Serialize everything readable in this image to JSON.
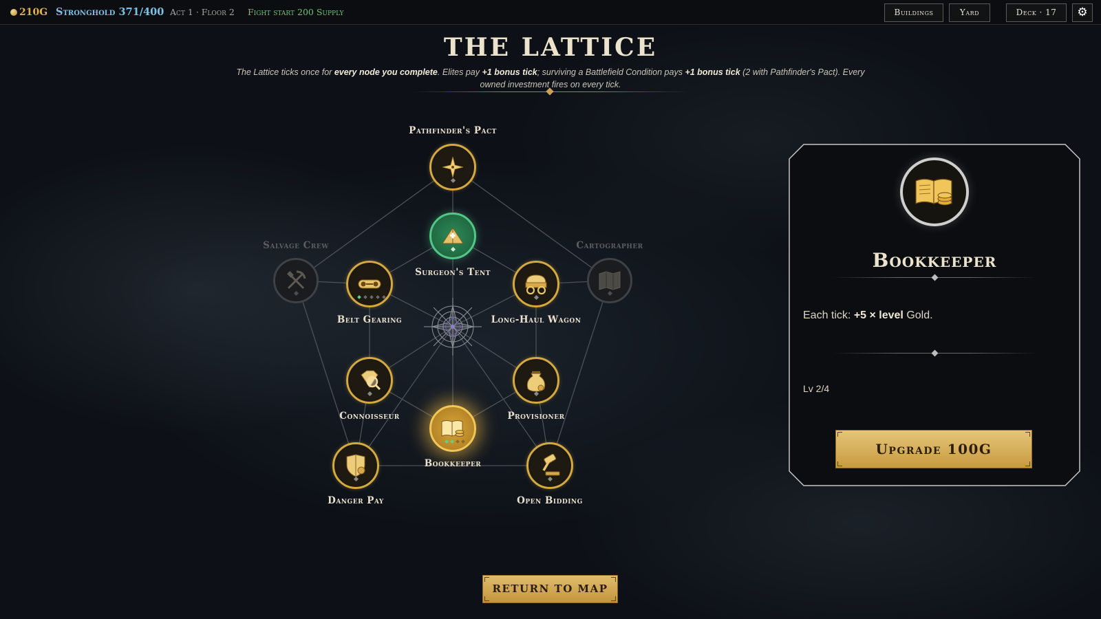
{
  "topbar": {
    "gold": "210G",
    "stronghold": "Stronghold 371/400",
    "act_floor": "Act 1 · Floor 2",
    "fight_start": "Fight start 200 Supply",
    "buttons": {
      "buildings": "Buildings",
      "yard": "Yard",
      "deck": "Deck · 17"
    },
    "settings_icon": "gear-icon"
  },
  "header": {
    "title": "THE LATTICE",
    "description_parts": [
      "The Lattice ticks once for ",
      "every node you complete",
      ". Elites pay ",
      "+1 bonus tick",
      "; surviving a Battlefield Condition pays ",
      "+1 bonus tick",
      " (2 with Pathfinder's Pact). Every owned investment fires on every tick."
    ]
  },
  "lattice": {
    "center_icon": "compass-rose-icon",
    "nodes": [
      {
        "id": "pathfinders-pact",
        "label": "Pathfinder's Pact",
        "icon": "compass-star-icon",
        "state": "owned"
      },
      {
        "id": "surgeons-tent",
        "label": "Surgeon's Tent",
        "icon": "medical-tent-icon",
        "state": "available"
      },
      {
        "id": "salvage-crew",
        "label": "Salvage Crew",
        "icon": "pickaxe-shovel-icon",
        "state": "locked"
      },
      {
        "id": "cartographer",
        "label": "Cartographer",
        "icon": "map-icon",
        "state": "locked"
      },
      {
        "id": "belt-gearing",
        "label": "Belt Gearing",
        "icon": "conveyor-belt-icon",
        "state": "owned",
        "level": 1,
        "max": 5
      },
      {
        "id": "long-haul-wagon",
        "label": "Long-Haul Wagon",
        "icon": "wagon-icon",
        "state": "owned"
      },
      {
        "id": "connoisseur",
        "label": "Connoisseur",
        "icon": "gem-magnifier-icon",
        "state": "owned"
      },
      {
        "id": "provisioner",
        "label": "Provisioner",
        "icon": "supply-sack-icon",
        "state": "owned"
      },
      {
        "id": "bookkeeper",
        "label": "Bookkeeper",
        "icon": "ledger-coins-icon",
        "state": "selected",
        "level": 2,
        "max": 4
      },
      {
        "id": "danger-pay",
        "label": "Danger Pay",
        "icon": "shield-coin-icon",
        "state": "owned"
      },
      {
        "id": "open-bidding",
        "label": "Open Bidding",
        "icon": "gavel-icon",
        "state": "owned"
      }
    ]
  },
  "detail": {
    "icon": "ledger-coins-icon",
    "title": "Bookkeeper",
    "desc_prefix": "Each tick: ",
    "desc_value": "+5 × level",
    "desc_suffix": " Gold.",
    "level": "Lv 2/4",
    "upgrade_label": "Upgrade 100G"
  },
  "footer": {
    "return_label": "RETURN TO MAP"
  },
  "colors": {
    "gold": "#d4a93f",
    "green": "#52c787",
    "locked": "#3e4246",
    "accent_text": "#ece3cc"
  }
}
